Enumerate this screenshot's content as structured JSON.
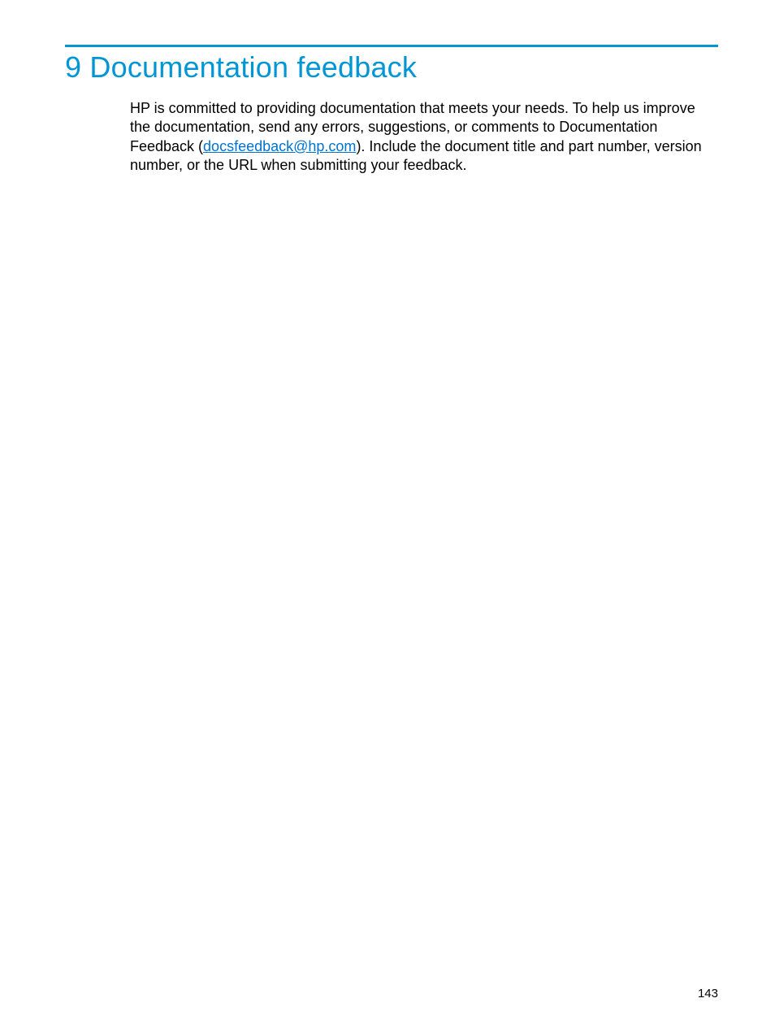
{
  "heading": "9 Documentation feedback",
  "body": {
    "pre": "HP is committed to providing documentation that meets your needs. To help us improve the documentation, send any errors, suggestions, or comments to Documentation Feedback (",
    "link": "docsfeedback@hp.com",
    "post": "). Include the document title and part number, version number, or the URL when submitting your feedback."
  },
  "pageNumber": "143",
  "colors": {
    "accent": "#0096d6",
    "link": "#0073cf"
  }
}
